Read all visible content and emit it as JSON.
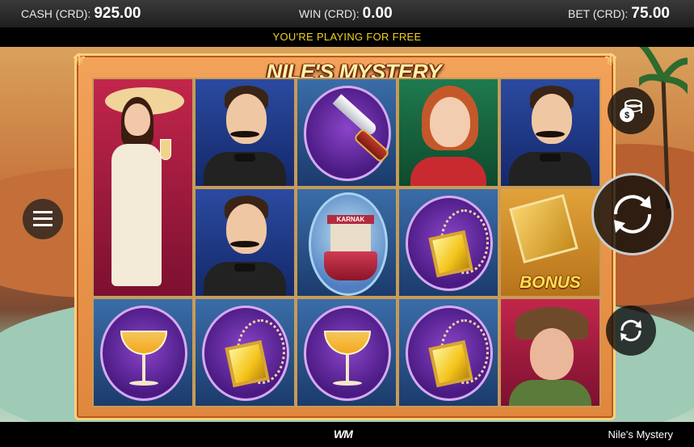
{
  "topbar": {
    "cash_label": "CASH (CRD):",
    "cash_value": "925.00",
    "win_label": "WIN (CRD):",
    "win_value": "0.00",
    "bet_label": "BET (CRD):",
    "bet_value": "75.00"
  },
  "notice": "YOU'RE PLAYING FOR FREE",
  "game": {
    "title": "NILE'S MYSTERY",
    "ship_label": "KARNAK",
    "bonus_label": "BONUS",
    "symbols": [
      [
        "lady-in-white",
        "gentleman",
        "gentleman",
        "cocktail-glass"
      ],
      [
        "knife",
        "karnak-ship",
        "cocktail-glass"
      ],
      [
        "red-haired-woman",
        "amulet-necklace",
        "amulet-necklace"
      ],
      [
        "gentleman",
        "bonus-box",
        "elderly-lady"
      ]
    ]
  },
  "controls": {
    "coins_icon": "coin-stack-icon",
    "spin_icon": "spin-arrows-icon",
    "autoplay_icon": "autoplay-icon",
    "menu_icon": "hamburger-menu-icon"
  },
  "footer": {
    "logo": "WM",
    "game_name": "Nile's Mystery"
  },
  "colors": {
    "accent": "#f2d21b",
    "frame": "#e0873d"
  }
}
